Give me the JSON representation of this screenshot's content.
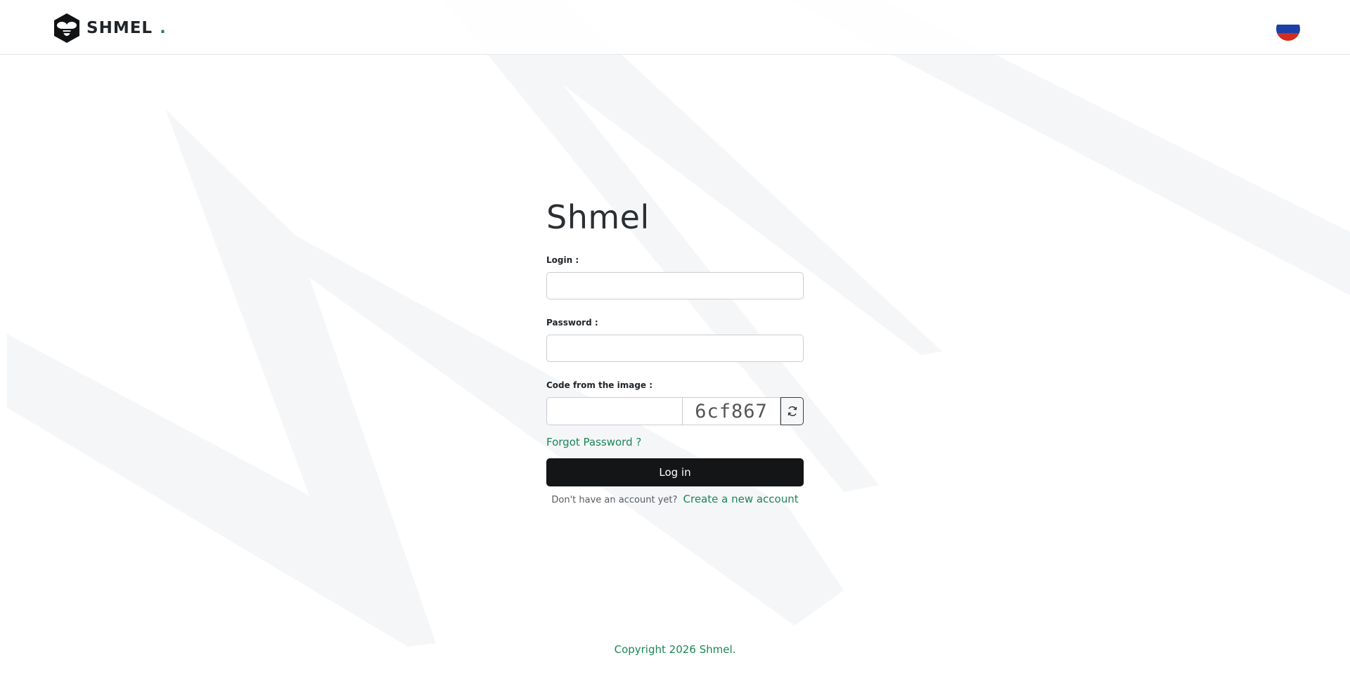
{
  "header": {
    "logo_text": "SHMEL",
    "logo_dot": ".",
    "language_flag_icon": "russia-flag-icon"
  },
  "form": {
    "title": "Shmel",
    "login_label": "Login :",
    "login_value": "",
    "password_label": "Password :",
    "password_value": "",
    "captcha_label": "Code from the image :",
    "captcha_value": "",
    "captcha_code": "6cf867",
    "refresh_icon": "refresh-icon",
    "forgot_password": "Forgot Password ?",
    "login_button": "Log in",
    "signup_prompt": "Don't have an account yet?",
    "signup_link": "Create a new account"
  },
  "footer": {
    "copyright": "Copyright 2026 Shmel."
  },
  "colors": {
    "accent_green": "#198754",
    "button_dark": "#141517",
    "flag_white": "#ffffff",
    "flag_blue": "#1c3fa8",
    "flag_red": "#d52b1e"
  }
}
